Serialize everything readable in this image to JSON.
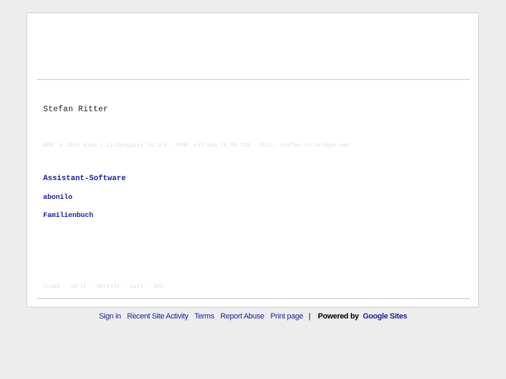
{
  "content": {
    "name": "Stefan Ritter",
    "contact": "ADR:  A-1070 Wien / Lindengasse 14/1/4 - MOB:  +43 660 74 88 330 - MAIL: stefan.ritter@gmx.net",
    "links": [
      "Assistant-Software",
      "abonilo",
      "Familienbuch"
    ],
    "footer_links": "inode - sprit -  derFalk - site - GMX"
  },
  "bottom_bar": {
    "sign_in": "Sign in",
    "recent_activity": "Recent Site Activity",
    "terms": "Terms",
    "report_abuse": "Report Abuse",
    "print_page": "Print page",
    "separator": "|",
    "powered_by": "Powered by",
    "google_sites": "Google Sites"
  },
  "colors": {
    "link": "#1a1aa8",
    "background": "#ededed",
    "faint_text": "#e0e0e0"
  }
}
